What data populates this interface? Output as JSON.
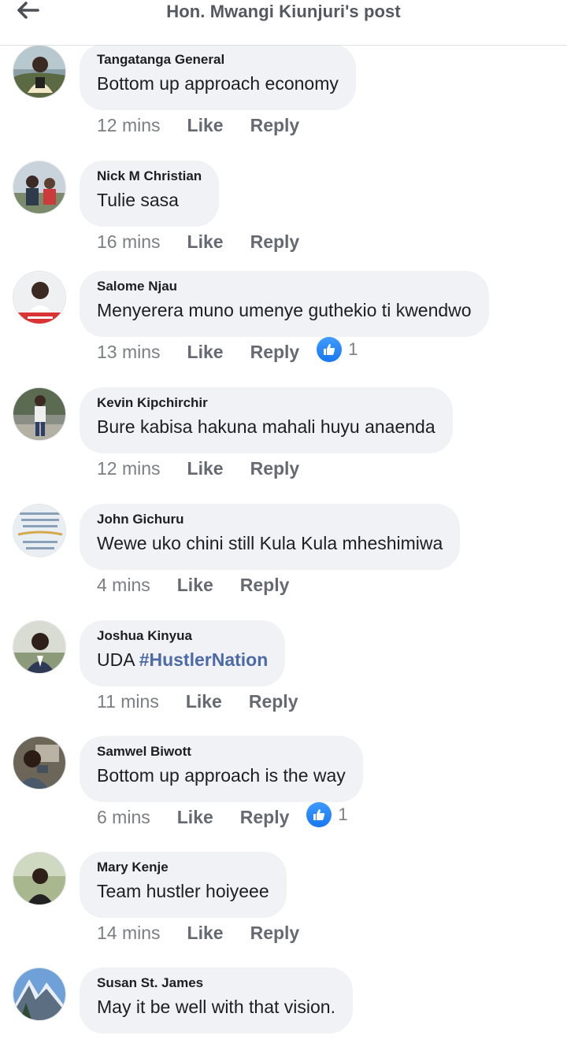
{
  "header": {
    "title": "Hon. Mwangi Kiunjuri's post",
    "back_icon": "arrow-left-icon"
  },
  "colors": {
    "bubble": "#f0f2f5",
    "hashtag": "#4e6aa6",
    "like_badge": "#1877f2",
    "meta_text": "#65676b"
  },
  "comments": [
    {
      "author": "Tangatanga General",
      "text": "Bottom up approach economy",
      "time": "12 mins",
      "like": "Like",
      "reply": "Reply",
      "reactions": ""
    },
    {
      "author": "Nick M Christian",
      "text": "Tulie sasa",
      "time": "16 mins",
      "like": "Like",
      "reply": "Reply",
      "reactions": ""
    },
    {
      "author": "Salome Njau",
      "text": "Menyerera muno umenye guthekio ti kwendwo",
      "time": "13 mins",
      "like": "Like",
      "reply": "Reply",
      "reactions": "1"
    },
    {
      "author": "Kevin Kipchirchir",
      "text": "Bure kabisa hakuna mahali huyu anaenda",
      "time": "12 mins",
      "like": "Like",
      "reply": "Reply",
      "reactions": ""
    },
    {
      "author": "John Gichuru",
      "text": "Wewe uko chini still Kula Kula mheshimiwa",
      "time": "4 mins",
      "like": "Like",
      "reply": "Reply",
      "reactions": ""
    },
    {
      "author": "Joshua Kinyua",
      "text_prefix": "UDA ",
      "hashtag": "#HustlerNation",
      "time": "11 mins",
      "like": "Like",
      "reply": "Reply",
      "reactions": ""
    },
    {
      "author": "Samwel Biwott",
      "text": "Bottom up approach is the way",
      "time": "6 mins",
      "like": "Like",
      "reply": "Reply",
      "reactions": "1"
    },
    {
      "author": "Mary Kenje",
      "text": "Team hustler hoiyeee",
      "time": "14 mins",
      "like": "Like",
      "reply": "Reply",
      "reactions": ""
    },
    {
      "author": "Susan St. James",
      "text": "May it be well with that vision.",
      "time": "",
      "like": "",
      "reply": "",
      "reactions": ""
    }
  ]
}
